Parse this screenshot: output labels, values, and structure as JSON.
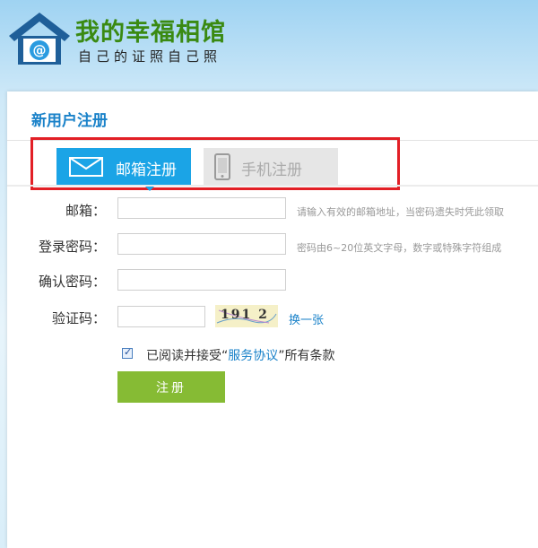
{
  "header": {
    "site_name": "我的幸福相馆",
    "slogan": "自己的证照自己照"
  },
  "panel": {
    "title": "新用户注册"
  },
  "tabs": [
    {
      "label": "邮箱注册",
      "icon": "envelope-icon",
      "active": true
    },
    {
      "label": "手机注册",
      "icon": "mobile-phone-icon",
      "active": false
    }
  ],
  "form": {
    "email_label": "邮箱：",
    "email_value": "",
    "email_hint": "请输入有效的邮箱地址，当密码遗失时凭此领取",
    "password_label": "登录密码：",
    "password_value": "",
    "password_hint": "密码由6~20位英文字母，数字或特殊字符组成",
    "confirm_label": "确认密码：",
    "confirm_value": "",
    "captcha_label": "验证码：",
    "captcha_value": "",
    "captcha_image_text": "191 2",
    "captcha_refresh": "换一张",
    "agree_prefix": "已阅读并接受“",
    "agree_link": "服务协议",
    "agree_suffix": "”所有条款",
    "agree_checked": true,
    "submit_label": "注册"
  },
  "colors": {
    "brand_green": "#3a8a12",
    "accent_blue": "#1ba4e6",
    "highlight_red": "#e21f26",
    "button_green": "#86bb34"
  }
}
